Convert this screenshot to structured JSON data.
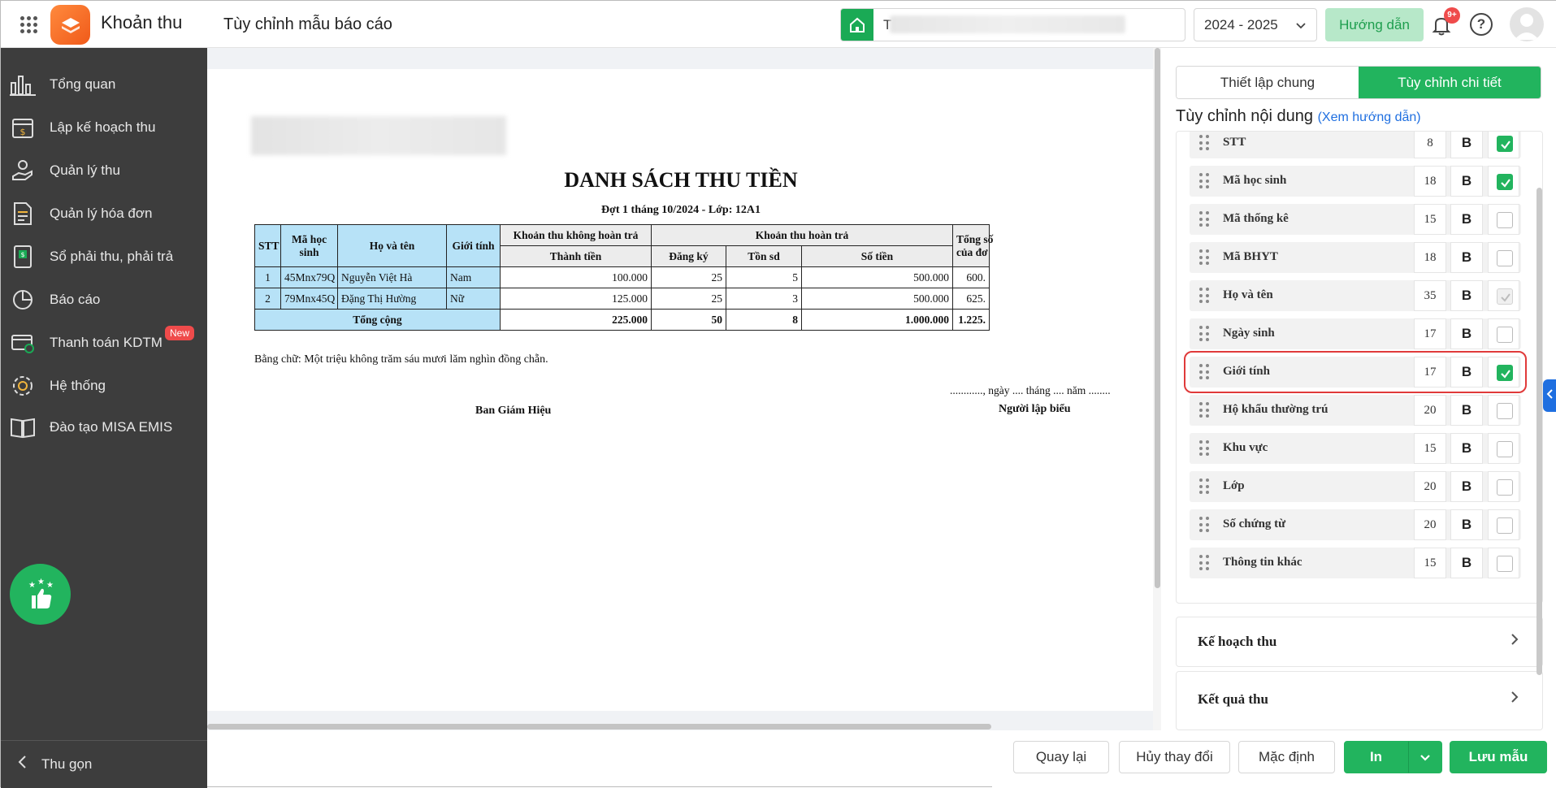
{
  "header": {
    "app_name": "Khoản thu",
    "page_title": "Tùy chỉnh mẫu báo cáo",
    "school_prefix": "T",
    "year": "2024 - 2025",
    "guide_label": "Hướng dẫn",
    "notification_count": "9+",
    "help_glyph": "?"
  },
  "sidebar": {
    "items": [
      {
        "label": "Tổng quan",
        "icon": "bar-chart-icon"
      },
      {
        "label": "Lập kế hoạch thu",
        "icon": "calendar-money-icon"
      },
      {
        "label": "Quản lý thu",
        "icon": "hand-coin-icon"
      },
      {
        "label": "Quản lý hóa đơn",
        "icon": "invoice-icon"
      },
      {
        "label": "Sổ phải thu, phải trả",
        "icon": "ledger-book-icon"
      },
      {
        "label": "Báo cáo",
        "icon": "pie-chart-icon"
      },
      {
        "label": "Thanh toán KDTM",
        "icon": "card-check-icon",
        "badge": "New"
      },
      {
        "label": "Hệ thống",
        "icon": "gear-icon"
      },
      {
        "label": "Đào tạo MISA EMIS",
        "icon": "open-book-icon"
      }
    ],
    "collapse_label": "Thu gọn"
  },
  "report": {
    "title": "DANH SÁCH THU TIỀN",
    "subtitle": "Đợt 1 tháng 10/2024 - Lớp: 12A1",
    "headers": {
      "stt": "STT",
      "student_code": "Mã học sinh",
      "full_name": "Họ và tên",
      "gender": "Giới tính",
      "group_nonrefund": "Khoản thu không hoàn trả",
      "group_refund": "Khoản thu hoàn trả",
      "total_partial_1": "Tổng số",
      "total_partial_2": "của đơ",
      "amount": "Thành tiền",
      "registered": "Đăng ký",
      "remaining": "Tồn sd",
      "money": "Số tiền"
    },
    "rows": [
      {
        "stt": "1",
        "code": "45Mnx79Q",
        "name": "Nguyễn Việt Hà",
        "gender": "Nam",
        "amount": "100.000",
        "registered": "25",
        "remaining": "5",
        "money": "500.000",
        "total": "600."
      },
      {
        "stt": "2",
        "code": "79Mnx45Q",
        "name": "Đặng Thị Hường",
        "gender": "Nữ",
        "amount": "125.000",
        "registered": "25",
        "remaining": "3",
        "money": "500.000",
        "total": "625."
      }
    ],
    "totals": {
      "label": "Tổng cộng",
      "amount": "225.000",
      "registered": "50",
      "remaining": "8",
      "money": "1.000.000",
      "total": "1.225."
    },
    "amount_in_words": "Bằng chữ: Một triệu không trăm sáu mươi lăm nghìn đồng chẵn.",
    "date_line": "............, ngày .... tháng .... năm ........",
    "sign_left": "Ban Giám Hiệu",
    "sign_right": "Người lập biểu"
  },
  "panel": {
    "tab_general": "Thiết lập chung",
    "tab_detail": "Tùy chỉnh chi tiết",
    "section_title": "Tùy chỉnh nội dung",
    "section_link": "(Xem hướng dẫn)",
    "bold_label": "B",
    "fields": [
      {
        "name": "STT",
        "width": "8",
        "state": "on"
      },
      {
        "name": "Mã học sinh",
        "width": "18",
        "state": "on"
      },
      {
        "name": "Mã thống kê",
        "width": "15",
        "state": "off"
      },
      {
        "name": "Mã BHYT",
        "width": "18",
        "state": "off"
      },
      {
        "name": "Họ và tên",
        "width": "35",
        "state": "disabled"
      },
      {
        "name": "Ngày sinh",
        "width": "17",
        "state": "off"
      },
      {
        "name": "Giới tính",
        "width": "17",
        "state": "on"
      },
      {
        "name": "Hộ khẩu thường trú",
        "width": "20",
        "state": "off"
      },
      {
        "name": "Khu vực",
        "width": "15",
        "state": "off"
      },
      {
        "name": "Lớp",
        "width": "20",
        "state": "off"
      },
      {
        "name": "Số chứng từ",
        "width": "20",
        "state": "off"
      },
      {
        "name": "Thông tin khác",
        "width": "15",
        "state": "off"
      }
    ],
    "accordions": [
      "Kế hoạch thu",
      "Kết quả thu"
    ]
  },
  "footer": {
    "back": "Quay lại",
    "discard": "Hủy thay đổi",
    "default": "Mặc định",
    "print": "In",
    "save": "Lưu mẫu"
  },
  "colors": {
    "accent": "#22b45e",
    "sidebar": "#3d3d3d",
    "highlight": "#e03a3a",
    "selection": "#b7e2f7"
  }
}
